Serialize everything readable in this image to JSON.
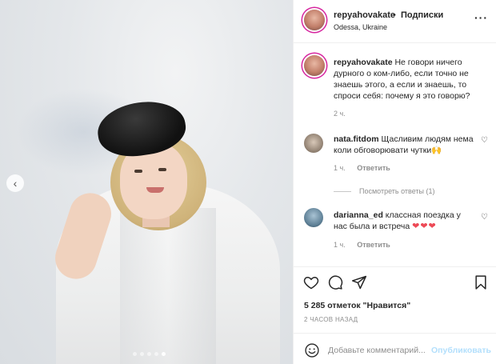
{
  "post": {
    "username": "repyahovakate",
    "separator": "•",
    "follow_label": "Подписки",
    "location": "Odessa, Ukraine",
    "more_icon": "more-horizontal-icon"
  },
  "caption": {
    "username": "repyahovakate",
    "text": "Не говори ничего дурного о ком-либо, если точно не знаешь этого, а если и знаешь, то спроси себя: почему я это говорю?",
    "time": "2 ч."
  },
  "comments": [
    {
      "username": "nata.fitdom",
      "text": "Щасливим людям нема коли обговорювати чутки🙌",
      "time": "1 ч.",
      "reply_label": "Ответить",
      "view_replies": "Посмотреть ответы (1)"
    },
    {
      "username": "darianna_ed",
      "text": "классная поездка у нас была и встреча",
      "hearts": "❤❤❤",
      "time": "1 ч.",
      "reply_label": "Ответить"
    }
  ],
  "actions": {
    "likes": "5 285 отметок \"Нравится\"",
    "posted_ago": "2 ЧАСОВ НАЗАД"
  },
  "add_comment": {
    "placeholder": "Добавьте комментарий...",
    "publish_label": "Опубликовать"
  },
  "carousel": {
    "total_slides": 5,
    "active_slide": 5,
    "prev_icon": "chevron-left-icon"
  },
  "colors": {
    "accent": "#0095f6",
    "publish_disabled": "#b2dffc",
    "heart": "#ed4956",
    "muted": "#8e8e8e"
  }
}
